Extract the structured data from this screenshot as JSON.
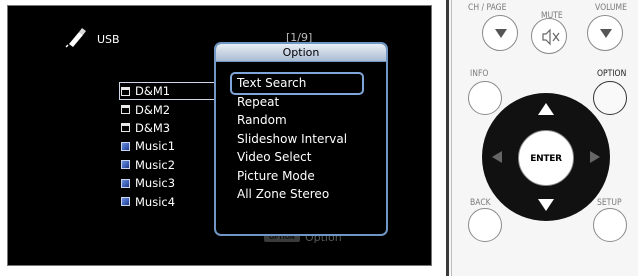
{
  "screen": {
    "source_label": "USB",
    "page_indicator": "[1/9]",
    "files": [
      {
        "name": "D&M1",
        "type": "folder",
        "selected": true
      },
      {
        "name": "D&M2",
        "type": "folder",
        "selected": false
      },
      {
        "name": "D&M3",
        "type": "folder",
        "selected": false
      },
      {
        "name": "Music1",
        "type": "music",
        "selected": false
      },
      {
        "name": "Music2",
        "type": "music",
        "selected": false
      },
      {
        "name": "Music3",
        "type": "music",
        "selected": false
      },
      {
        "name": "Music4",
        "type": "music",
        "selected": false
      }
    ],
    "option_popup": {
      "title": "Option",
      "items": [
        "Text Search",
        "Repeat",
        "Random",
        "Slideshow Interval",
        "Video Select",
        "Picture Mode",
        "All Zone Stereo"
      ],
      "highlighted_index": 0
    },
    "hint": {
      "badge": "OPTION",
      "label": "Option"
    }
  },
  "remote": {
    "labels": {
      "ch_page": "CH / PAGE",
      "mute": "MUTE",
      "volume": "VOLUME",
      "info": "INFO",
      "option": "OPTION",
      "enter": "ENTER",
      "back": "BACK",
      "setup": "SETUP"
    }
  },
  "colors": {
    "popup_border": "#6f96c4",
    "highlight": "#7fa6d8",
    "screen_bg": "#000000"
  }
}
